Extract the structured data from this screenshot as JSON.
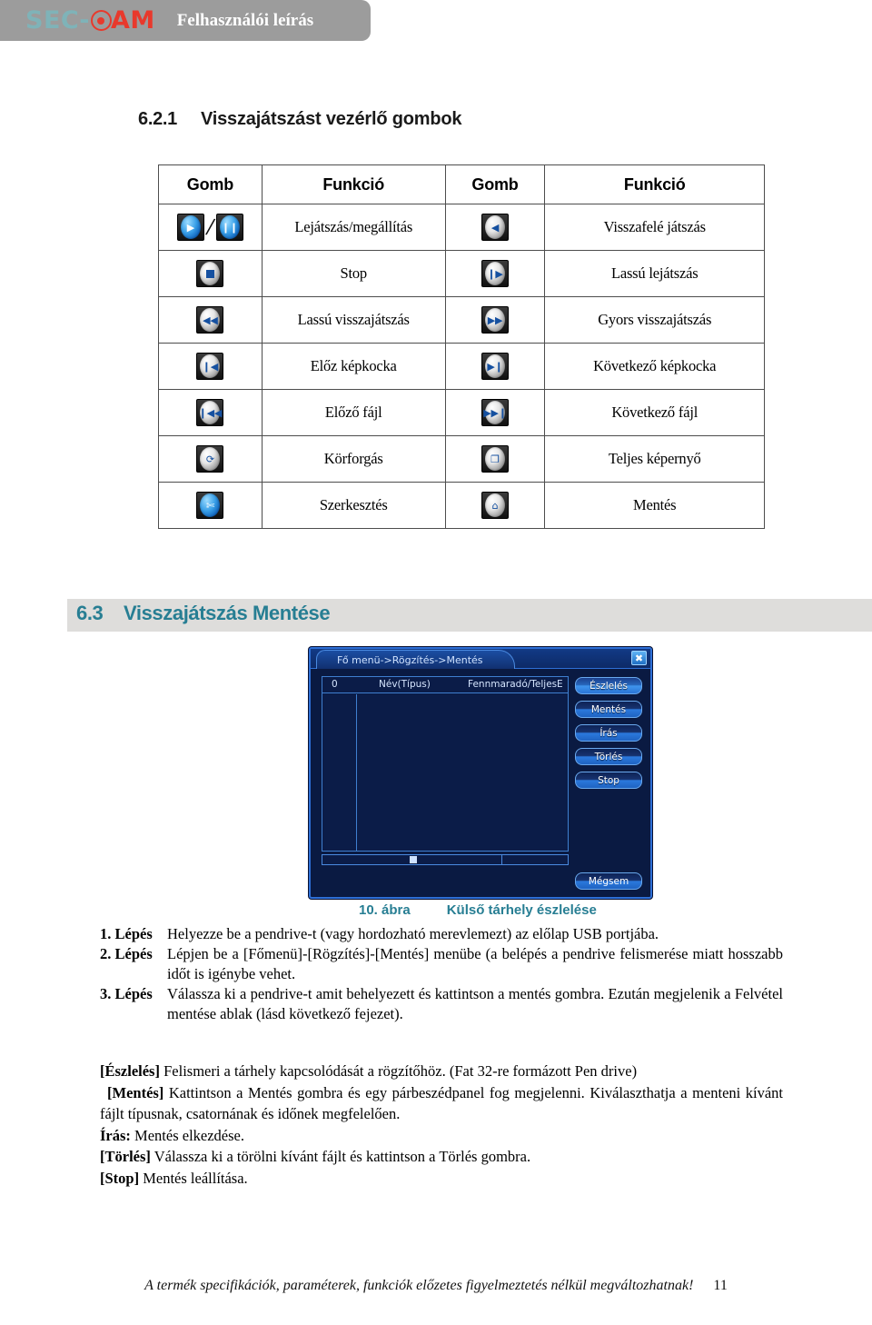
{
  "header": {
    "logo_sec": "SEC",
    "logo_dash": "-",
    "logo_target_icon": "target-icon",
    "logo_cam": "AM",
    "title": "Felhasználói leírás",
    "band_color": "#9c9c9c",
    "logo_teal": "#7fb3b8",
    "logo_red": "#e8392c"
  },
  "section_621": {
    "number": "6.2.1",
    "title": "Visszajátszást vezérlő gombok"
  },
  "button_table": {
    "headers": [
      "Gomb",
      "Funkció",
      "Gomb",
      "Funkció"
    ],
    "rows": [
      {
        "icon_left": "play-pause-icon",
        "func_left": "Lejátszás/megállítás",
        "icon_right": "reverse-play-icon",
        "func_right": "Visszafelé játszás"
      },
      {
        "icon_left": "stop-icon",
        "func_left": "Stop",
        "icon_right": "slow-play-icon",
        "func_right": "Lassú lejátszás"
      },
      {
        "icon_left": "rewind-icon",
        "func_left": "Lassú visszajátszás",
        "icon_right": "fast-forward-icon",
        "func_right": "Gyors visszajátszás"
      },
      {
        "icon_left": "previous-frame-icon",
        "func_left": "Előz képkocka",
        "icon_right": "next-frame-icon",
        "func_right": "Következő képkocka"
      },
      {
        "icon_left": "previous-file-icon",
        "func_left": "Előző fájl",
        "icon_right": "next-file-icon",
        "func_right": "Következő fájl"
      },
      {
        "icon_left": "rotate-icon",
        "func_left": "Körforgás",
        "icon_right": "fullscreen-icon",
        "func_right": "Teljes képernyő"
      },
      {
        "icon_left": "scissors-edit-icon",
        "func_left": "Szerkesztés",
        "icon_right": "backup-save-icon",
        "func_right": "Mentés"
      }
    ]
  },
  "section_63": {
    "number": "6.3",
    "title": "Visszajátszás Mentése",
    "accent_color": "#277e93",
    "band_color": "#dedddb"
  },
  "dvr_dialog": {
    "title": "Fő menü->Rögzítés->Mentés",
    "close_label": "✖",
    "list": {
      "columns": [
        "0",
        "Név(Típus)",
        "Fennmaradó/Teljes",
        "E"
      ]
    },
    "buttons": [
      {
        "label": "Észlelés",
        "primary": true
      },
      {
        "label": "Mentés",
        "primary": false
      },
      {
        "label": "Írás",
        "primary": false
      },
      {
        "label": "Törlés",
        "primary": false
      },
      {
        "label": "Stop",
        "primary": false
      }
    ],
    "cancel_label": "Mégsem"
  },
  "figure": {
    "label": "10. ábra",
    "caption": "Külső tárhely észlelése"
  },
  "steps": [
    {
      "label": "1. Lépés",
      "text": "Helyezze be a pendrive-t (vagy hordozható merevlemezt) az előlap USB portjába."
    },
    {
      "label": "2. Lépés",
      "text": "Lépjen be a [Főmenü]-[Rögzítés]-[Mentés] menübe (a belépés a pendrive felismerése miatt hosszabb időt is igénybe vehet."
    },
    {
      "label": "3. Lépés",
      "text": "Válassza ki a pendrive-t amit behelyezett és kattintson a mentés gombra. Ezután megjelenik a Felvétel mentése ablak (lásd következő fejezet)."
    }
  ],
  "descriptions": [
    {
      "term": "[Észlelés]",
      "text": " Felismeri a tárhely kapcsolódását a rögzítőhöz. (Fat 32-re formázott Pen drive)"
    },
    {
      "term": "[Mentés]",
      "text": " Kattintson a Mentés gombra és egy párbeszédpanel fog megjelenni. Kiválaszthatja a menteni kívánt fájlt típusnak, csatornának és időnek megfelelően."
    },
    {
      "term": "Írás:",
      "text": " Mentés elkezdése."
    },
    {
      "term": "[Törlés]",
      "text": " Válassza ki a törölni kívánt fájlt és kattintson a Törlés gombra."
    },
    {
      "term": "[Stop]",
      "text": " Mentés leállítása."
    }
  ],
  "footer": {
    "text": "A termék specifikációk, paraméterek, funkciók előzetes figyelmeztetés nélkül megváltozhatnak!",
    "page": "11"
  }
}
